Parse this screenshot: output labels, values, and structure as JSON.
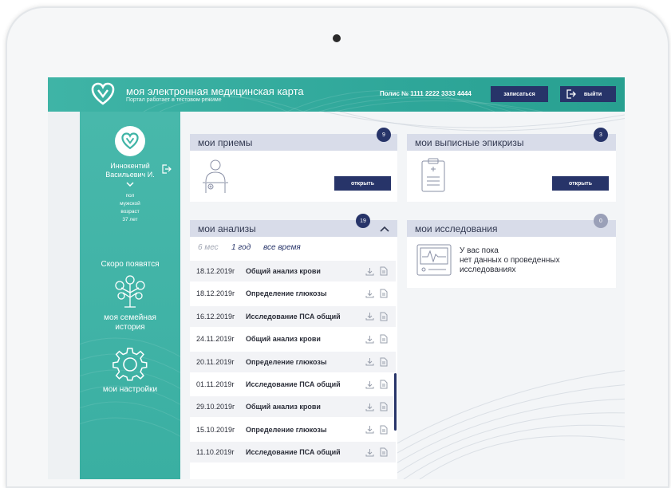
{
  "header": {
    "title": "моя электронная медицинская карта",
    "subtitle": "Портал работает в тестовом режиме",
    "polis": "Полис № 1111 2222 3333 4444",
    "signup_label": "записаться",
    "logout_label": "выйти"
  },
  "profile": {
    "name_line1": "Иннокентий",
    "name_line2": "Васильевич И.",
    "gender_label": "пол",
    "gender": "мужской",
    "age_label": "возраст",
    "age": "37 лет"
  },
  "sidebar": {
    "coming_soon": "Скоро появятся",
    "family_line1": "моя семейная",
    "family_line2": "история",
    "settings": "мои настройки"
  },
  "appointments": {
    "title": "мои приемы",
    "count": "9",
    "open_label": "открыть"
  },
  "discharges": {
    "title": "мои выписные эпикризы",
    "count": "3",
    "open_label": "открыть"
  },
  "research": {
    "title": "мои исследования",
    "count": "0",
    "empty_line1": "У вас пока",
    "empty_line2": "нет данных о проведенных",
    "empty_line3": "исследованиях"
  },
  "analyses": {
    "title": "мои анализы",
    "count": "19",
    "filters": [
      "6 мес",
      "1 год",
      "все время"
    ],
    "rows": [
      {
        "date": "18.12.2019г",
        "name": "Общий анализ крови"
      },
      {
        "date": "18.12.2019г",
        "name": "Определение глюкозы"
      },
      {
        "date": "16.12.2019г",
        "name": "Исследование ПСА общий"
      },
      {
        "date": "24.11.2019г",
        "name": "Общий анализ крови"
      },
      {
        "date": "20.11.2019г",
        "name": "Определение глюкозы"
      },
      {
        "date": "01.11.2019г",
        "name": "Исследование ПСА общий"
      },
      {
        "date": "29.10.2019г",
        "name": "Общий анализ крови"
      },
      {
        "date": "15.10.2019г",
        "name": "Определение глюкозы"
      },
      {
        "date": "11.10.2019г",
        "name": "Исследование ПСА общий"
      }
    ]
  },
  "colors": {
    "teal": "#3fb4a6",
    "navy": "#273469",
    "card_head": "#d8dce9"
  }
}
